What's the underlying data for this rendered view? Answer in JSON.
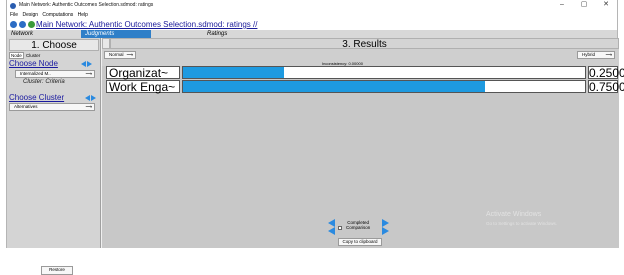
{
  "window": {
    "title": "Main Network: Authentic Outcomes Selection.sdmod: ratings",
    "minimize": "–",
    "maximize": "▢",
    "close": "✕"
  },
  "menu": [
    "File",
    "Design",
    "Computations",
    "Help"
  ],
  "nav": {
    "path": "Main Network: Authentic Outcomes Selection.sdmod: ratings //"
  },
  "tabs": [
    "Network",
    "Judgments",
    "Ratings"
  ],
  "left": {
    "header": "1. Choose",
    "node_tab": "Node",
    "cluster_tab": "Cluster",
    "choose_node": "Choose Node",
    "node_select": "Internalized M..",
    "cluster_label": "Cluster: Criteria",
    "choose_cluster": "Choose Cluster",
    "cluster_select": "Alternatives",
    "restore": "Restore"
  },
  "right": {
    "header": "3. Results",
    "mode": "Normal",
    "inconsistency": "Inconsistency: 0.00000",
    "hybrid": "Hybrid",
    "completed": "Completed",
    "comparison": "Comparison",
    "copy": "Copy to clipboard",
    "watermark_title": "Activate Windows",
    "watermark_sub": "Go to Settings to activate Windows."
  },
  "colors": {
    "bar": "#1e9ae0",
    "tab_active": "#2f7fc8"
  },
  "chart_data": {
    "type": "bar",
    "categories": [
      "Organizat~",
      "Work Enga~"
    ],
    "values": [
      0.25,
      0.75
    ],
    "value_labels": [
      "0.25000",
      "0.75000"
    ]
  }
}
